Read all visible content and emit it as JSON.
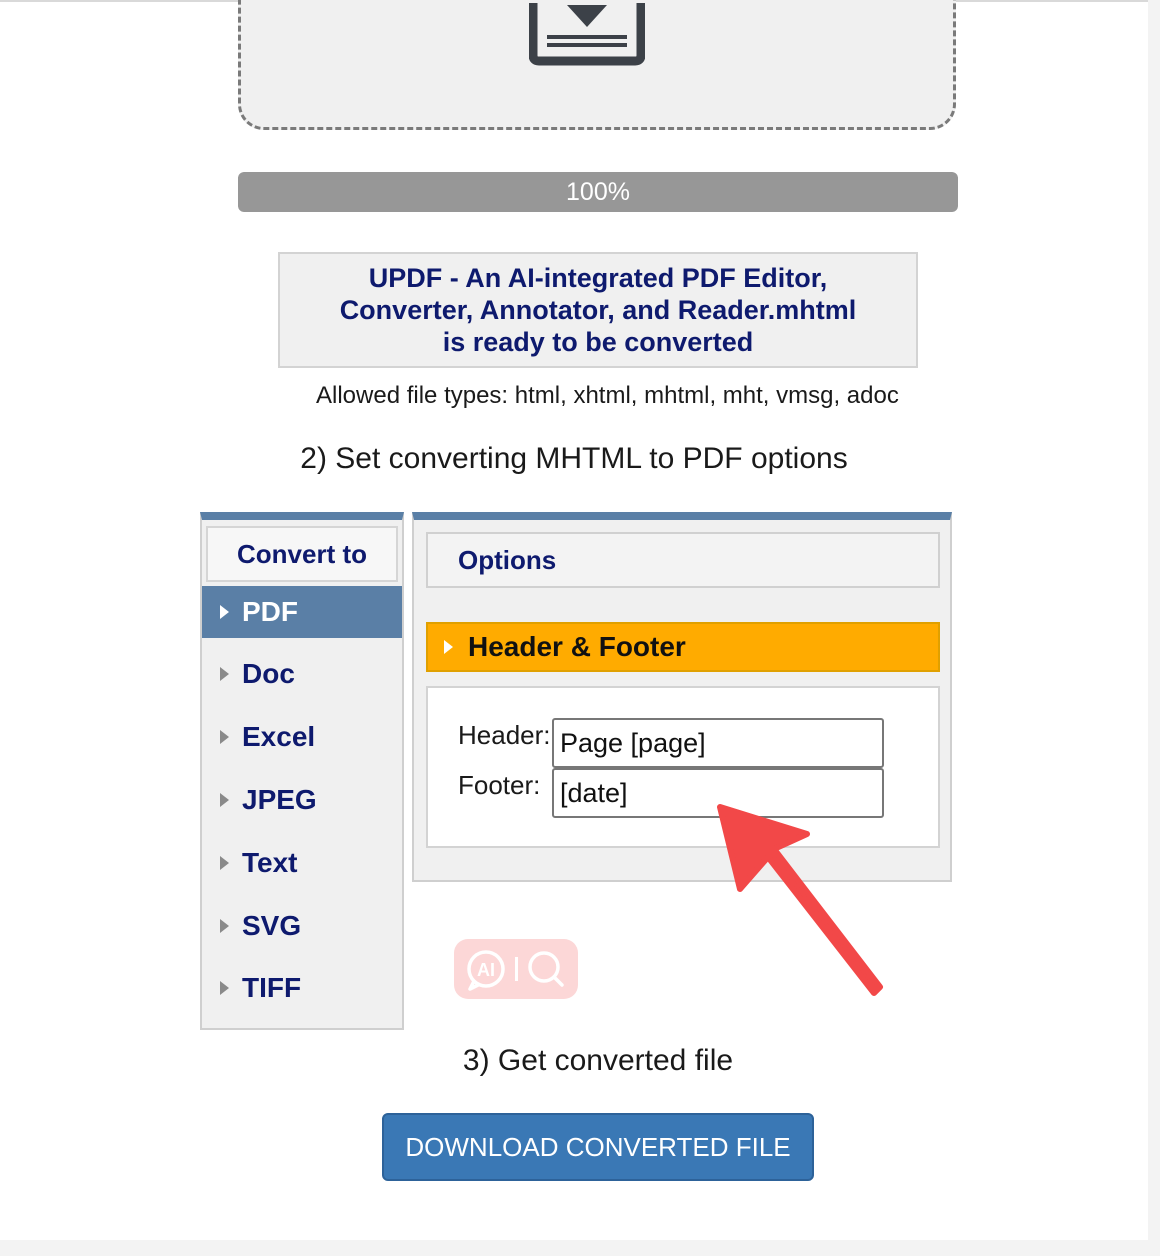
{
  "upload": {
    "icon": "download-tray-icon"
  },
  "progress": {
    "percent": 100,
    "label": "100%"
  },
  "file_status": {
    "line1": "UPDF - An AI-integrated PDF Editor,",
    "line2": "Converter, Annotator, and Reader.mhtml",
    "line3": "is ready to be converted"
  },
  "allowed_types": "Allowed file types: html, xhtml, mhtml, mht, vmsg, adoc",
  "step2": {
    "title": "2) Set converting MHTML to PDF options"
  },
  "convert_to": {
    "title": "Convert to",
    "formats": [
      {
        "label": "PDF",
        "active": true
      },
      {
        "label": "Doc"
      },
      {
        "label": "Excel"
      },
      {
        "label": "JPEG"
      },
      {
        "label": "Text"
      },
      {
        "label": "SVG"
      },
      {
        "label": "TIFF"
      }
    ]
  },
  "options": {
    "title": "Options",
    "section": "Header & Footer",
    "header_label": "Header:",
    "header_value": "Page [page]",
    "footer_label": "Footer:",
    "footer_value": "[date]"
  },
  "ai_widget": {
    "icons": [
      "ai-icon",
      "search-icon"
    ]
  },
  "step3": {
    "title": "3) Get converted file"
  },
  "download": {
    "label": "DOWNLOAD CONVERTED FILE",
    "color": "#3a78b5"
  },
  "colors": {
    "accent": "#5a7fa6",
    "highlight": "#ffab00",
    "heading": "#0e1a6e",
    "arrow": "#f24848"
  }
}
